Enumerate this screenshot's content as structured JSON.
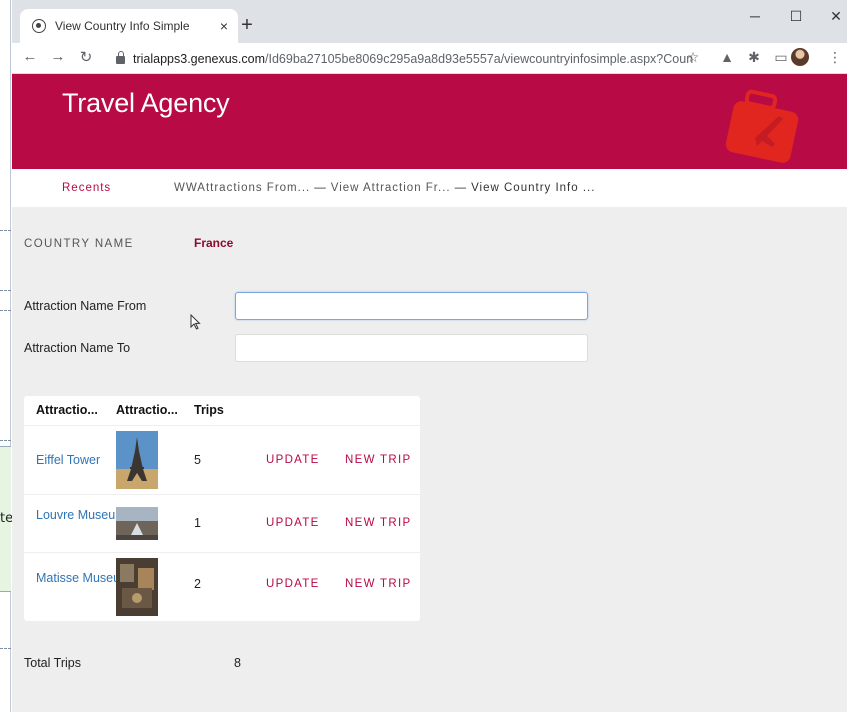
{
  "browser": {
    "tab_title": "View Country Info Simple",
    "tab_close": "×",
    "new_tab": "+",
    "url_host": "trialapps3.genexus.com",
    "url_path": "/Id69ba27105be8069c295a9a8d93e5557a/viewcountryinfosimple.aspx?Countr..."
  },
  "app": {
    "title": "Travel Agency",
    "brand_color": "#b80a45"
  },
  "nav": {
    "recents": "Recents",
    "breadcrumbs": [
      "WWAttractions From...",
      "View Attraction Fr...",
      "View Country Info ..."
    ],
    "separator": "—"
  },
  "form": {
    "country_label": "COUNTRY NAME",
    "country_value": "France",
    "from_label": "Attraction Name From",
    "from_value": "",
    "to_label": "Attraction Name To",
    "to_value": ""
  },
  "grid": {
    "headers": [
      "Attractio...",
      "Attractio...",
      "Trips"
    ],
    "rows": [
      {
        "name": "Eiffel Tower",
        "image": "eiffel-tower-photo",
        "trips": "5",
        "update": "UPDATE",
        "new_trip": "NEW TRIP"
      },
      {
        "name": "Louvre Museum",
        "image": "louvre-photo",
        "trips": "1",
        "update": "UPDATE",
        "new_trip": "NEW TRIP"
      },
      {
        "name": "Matisse Museum",
        "image": "matisse-museum-photo",
        "trips": "2",
        "update": "UPDATE",
        "new_trip": "NEW TRIP"
      }
    ]
  },
  "totals": {
    "label": "Total Trips",
    "value": "8"
  },
  "background_window": {
    "text": "te"
  }
}
